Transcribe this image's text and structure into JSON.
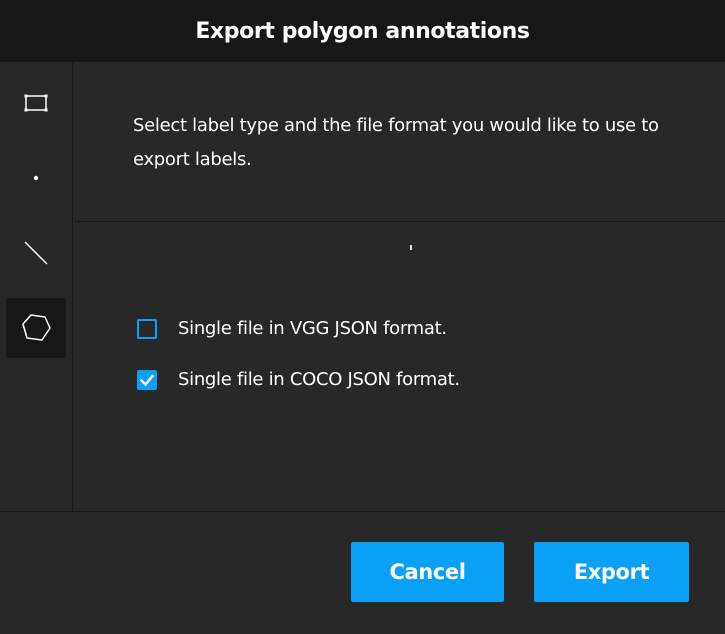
{
  "dialog": {
    "title": "Export polygon annotations",
    "description": "Select label type and the file format you would like to use to export labels."
  },
  "sidebar": {
    "tools": [
      {
        "name": "rectangle",
        "icon": "rectangle-icon",
        "active": false
      },
      {
        "name": "point",
        "icon": "point-icon",
        "active": false
      },
      {
        "name": "line",
        "icon": "line-icon",
        "active": false
      },
      {
        "name": "polygon",
        "icon": "polygon-icon",
        "active": true
      }
    ]
  },
  "options": [
    {
      "label": "Single file in VGG JSON format.",
      "checked": false
    },
    {
      "label": "Single file in COCO JSON format.",
      "checked": true
    }
  ],
  "buttons": {
    "cancel_label": "Cancel",
    "export_label": "Export"
  },
  "colors": {
    "accent": "#0aa0f5",
    "header_bg": "#171717",
    "dialog_bg": "#282828",
    "text": "#ffffff"
  }
}
